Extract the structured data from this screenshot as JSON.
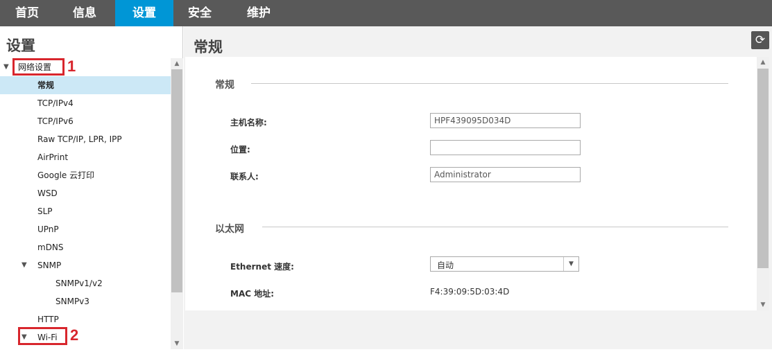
{
  "topnav": {
    "tabs": [
      "首页",
      "信息",
      "设置",
      "安全",
      "维护"
    ],
    "active_index": 2
  },
  "left_panel": {
    "title": "设置",
    "tree": [
      {
        "label": "网络设置",
        "level": 0,
        "expanded": true,
        "highlight": "1"
      },
      {
        "label": "常规",
        "level": 1,
        "selected": true
      },
      {
        "label": "TCP/IPv4",
        "level": 1
      },
      {
        "label": "TCP/IPv6",
        "level": 1
      },
      {
        "label": "Raw TCP/IP, LPR, IPP",
        "level": 1
      },
      {
        "label": "AirPrint",
        "level": 1
      },
      {
        "label": "Google 云打印",
        "level": 1
      },
      {
        "label": "WSD",
        "level": 1
      },
      {
        "label": "SLP",
        "level": 1
      },
      {
        "label": "UPnP",
        "level": 1
      },
      {
        "label": "mDNS",
        "level": 1
      },
      {
        "label": "SNMP",
        "level": 1,
        "expanded": true
      },
      {
        "label": "SNMPv1/v2",
        "level": 2
      },
      {
        "label": "SNMPv3",
        "level": 2
      },
      {
        "label": "HTTP",
        "level": 1
      },
      {
        "label": "Wi-Fi",
        "level": 1,
        "expanded": true,
        "highlight": "2"
      }
    ]
  },
  "main": {
    "title": "常规",
    "refresh_icon": "refresh-icon",
    "sections": {
      "general": {
        "title": "常规",
        "hostname_label": "主机名称:",
        "hostname_value": "HPF439095D034D",
        "location_label": "位置:",
        "location_value": "",
        "contact_label": "联系人:",
        "contact_value": "Administrator"
      },
      "ethernet": {
        "title": "以太网",
        "speed_label": "Ethernet 速度:",
        "speed_value": "自动",
        "mac_label": "MAC 地址:",
        "mac_value": "F4:39:09:5D:03:4D"
      }
    }
  },
  "colors": {
    "nav_bg": "#595959",
    "nav_active": "#0096d6",
    "selected_row": "#cce8f6",
    "annotation_red": "#d8262d"
  }
}
